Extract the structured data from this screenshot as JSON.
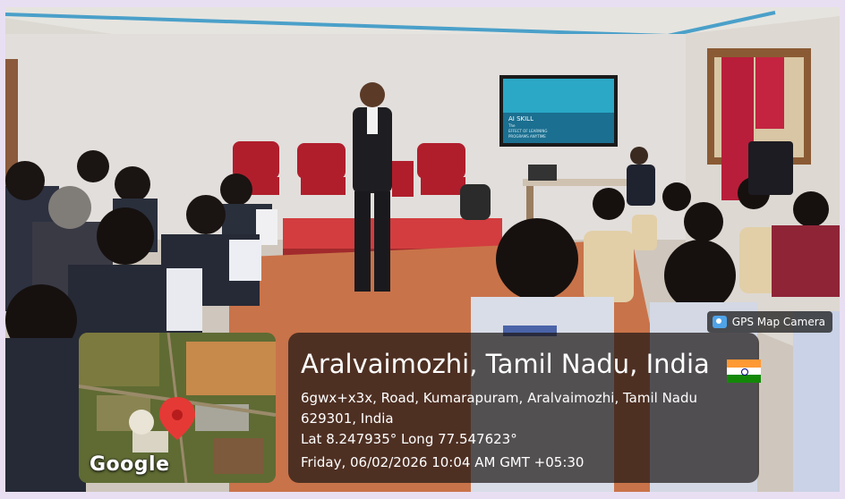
{
  "gps_tag": {
    "label": "GPS Map Camera",
    "icon": "camera-icon"
  },
  "map": {
    "brand": "Google",
    "pin_color": "#e53935",
    "icon": "map-pin-icon"
  },
  "location": {
    "place": "Aralvaimozhi, Tamil Nadu, India",
    "address": "6gwx+x3x, Road, Kumarapuram, Aralvaimozhi, Tamil Nadu 629301, India",
    "coordinates": "Lat 8.247935° Long 77.547623°",
    "datetime": "Friday, 06/02/2026 10:04 AM GMT +05:30",
    "flag": {
      "icon": "india-flag-icon",
      "colors": [
        "#ff9933",
        "#ffffff",
        "#138808"
      ]
    }
  },
  "screen_slide": {
    "heading": "AI SKILL",
    "lines": [
      "The",
      "EFFECT OF LEARNING",
      "PROGRAMS ANYTIME"
    ]
  }
}
